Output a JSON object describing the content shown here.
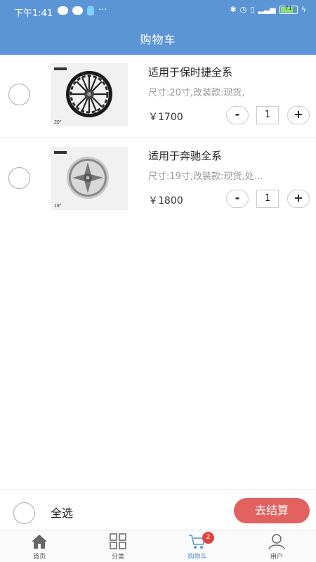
{
  "status_bar": {
    "time": "下午1:41",
    "battery": "71"
  },
  "header": {
    "title": "购物车"
  },
  "cart": {
    "items": [
      {
        "name": "适用于保时捷全系",
        "spec": "尺寸:20寸,改装款:现货,",
        "price": "￥1700",
        "quantity": "1",
        "image_size_label": "20\"",
        "selected": false
      },
      {
        "name": "适用于奔驰全系",
        "spec": "尺寸:19寸,改装款:现货,处…",
        "price": "￥1800",
        "quantity": "1",
        "image_size_label": "19\"",
        "selected": false
      }
    ],
    "decrement_label": "-",
    "increment_label": "+"
  },
  "footer": {
    "select_all_label": "全选",
    "checkout_label": "去结算"
  },
  "tabbar": {
    "tabs": [
      {
        "label": "首页",
        "icon": "home-icon"
      },
      {
        "label": "分类",
        "icon": "grid-icon"
      },
      {
        "label": "购物车",
        "icon": "cart-icon",
        "badge": "2",
        "active": true
      },
      {
        "label": "用户",
        "icon": "user-icon"
      }
    ]
  },
  "colors": {
    "header": "#5b95d6",
    "checkout": "#e2625f",
    "badge": "#e0423f",
    "active_tab": "#5b95d6"
  }
}
